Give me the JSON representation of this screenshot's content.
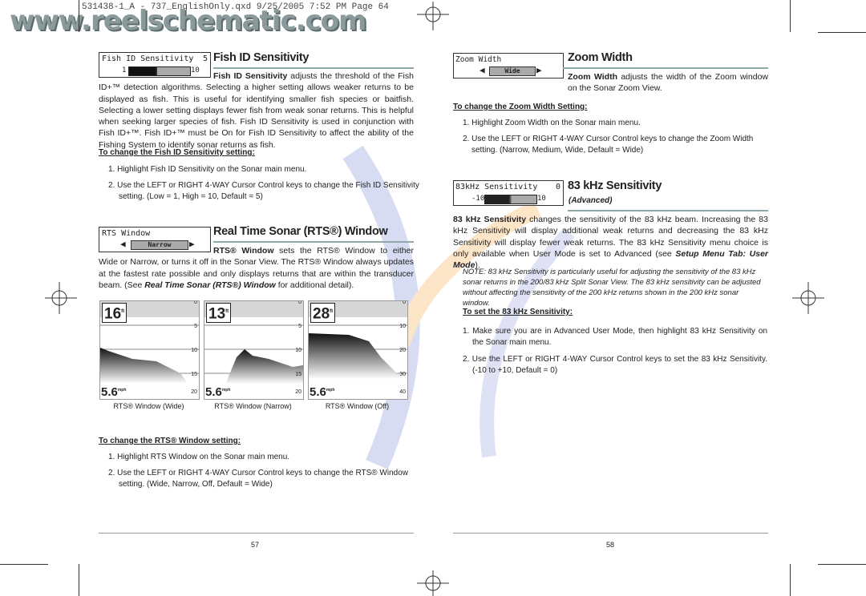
{
  "print_header": "531438-1_A - 737_EnglishOnly.qxd  9/25/2005  7:52 PM  Page 64",
  "watermark": "www.reelschematic.com",
  "left": {
    "fish_id": {
      "menu": {
        "label": "Fish ID Sensitivity",
        "value": "5",
        "min": "1",
        "max": "10",
        "level": 5
      },
      "title": "Fish ID Sensitivity",
      "lead": "Fish ID Sensitivity",
      "body": " adjusts the threshold of the Fish ID+™ detection algorithms.  Selecting a higher setting allows weaker returns to be displayed as fish. This is useful for identifying smaller fish species or baitfish.  Selecting a lower setting displays fewer fish from weak sonar returns.  This is helpful when seeking larger species of fish. Fish ID Sensitivity is used in conjunction with Fish ID+™. Fish ID+™ must be On for Fish ID Sensitivity to affect the ability of the Fishing System to identify sonar returns as fish.",
      "subhead": "To change the Fish ID Sensitivity setting:",
      "steps": [
        "1.  Highlight Fish ID Sensitivity on the Sonar main menu.",
        "2.  Use the LEFT or RIGHT 4-WAY Cursor Control keys to change the Fish ID Sensitivity setting. (Low = 1, High = 10, Default = 5)"
      ]
    },
    "rts": {
      "menu": {
        "label": "RTS Window",
        "value": "Narrow"
      },
      "title": "Real Time Sonar (RTS®) Window",
      "lead": "RTS® Window",
      "body": " sets the RTS® Window to either Wide or Narrow, or turns it off in the Sonar View. The RTS® Window always updates at the fastest rate possible and only displays returns that are within the transducer beam. (See ",
      "ref": "Real Time Sonar (RTS®) Window",
      "body_end": " for additional detail).",
      "screens": [
        {
          "depth": "16",
          "unit": "ft",
          "speed": "5.6",
          "speed_unit": "mph",
          "scale": [
            "0",
            "5",
            "10",
            "15",
            "20"
          ],
          "caption": "RTS® Window (Wide)"
        },
        {
          "depth": "13",
          "unit": "ft",
          "speed": "5.6",
          "speed_unit": "mph",
          "scale": [
            "0",
            "5",
            "10",
            "15",
            "20"
          ],
          "caption": "RTS® Window (Narrow)"
        },
        {
          "depth": "28",
          "unit": "ft",
          "speed": "5.6",
          "speed_unit": "mph",
          "scale": [
            "0",
            "10",
            "20",
            "30",
            "40"
          ],
          "caption": "RTS® Window (Off)"
        }
      ],
      "subhead": "To change the RTS® Window setting:",
      "steps": [
        "1.  Highlight RTS Window on the Sonar main menu.",
        "2.  Use the LEFT or RIGHT 4-WAY Cursor Control keys to change the RTS® Window setting. (Wide, Narrow, Off, Default = Wide)"
      ]
    },
    "page_number": "57"
  },
  "right": {
    "zoom": {
      "menu": {
        "label": "Zoom Width",
        "value": "Wide"
      },
      "title": "Zoom Width",
      "lead": "Zoom Width",
      "body": " adjusts the width of the Zoom window on the Sonar Zoom View.",
      "subhead": "To change the Zoom Width Setting:",
      "steps": [
        "1. Highlight Zoom Width on the Sonar main menu.",
        "2. Use the LEFT or RIGHT 4-WAY Cursor Control keys to change the Zoom Width setting. (Narrow, Medium, Wide, Default = Wide)"
      ]
    },
    "khz": {
      "menu": {
        "label": "83kHz Sensitivity",
        "value": "0",
        "min": "-10",
        "max": "10",
        "level": 0
      },
      "title": "83 kHz Sensitivity",
      "badge": "(Advanced)",
      "lead": "83 kHz Sensitivity",
      "body": " changes the sensitivity of the 83 kHz beam. Increasing the 83 kHz Sensitivity will display additional weak returns and decreasing the 83 kHz Sensitivity will display fewer weak returns. The 83 kHz Sensitivity menu choice is only available when User Mode is set to Advanced (see ",
      "ref": "Setup Menu Tab: User Mode",
      "body_end": ").",
      "note": "NOTE: 83 kHz Sensitivity is particularly useful for adjusting the sensitivity of the 83 kHz sonar returns in the 200/83 kHz Split Sonar View. The 83 kHz sensitivity can be adjusted without affecting the sensitivity of the 200 kHz returns shown in the 200 kHz sonar window.",
      "subhead": "To set the 83 kHz Sensitivity:",
      "steps": [
        "1.  Make sure you are in Advanced User Mode, then highlight 83 kHz Sensitivity on the Sonar main menu.",
        "2.  Use the LEFT or RIGHT 4-WAY Cursor Control keys to set the 83 kHz Sensitivity. (-10 to +10, Default = 0)"
      ]
    },
    "page_number": "58"
  }
}
